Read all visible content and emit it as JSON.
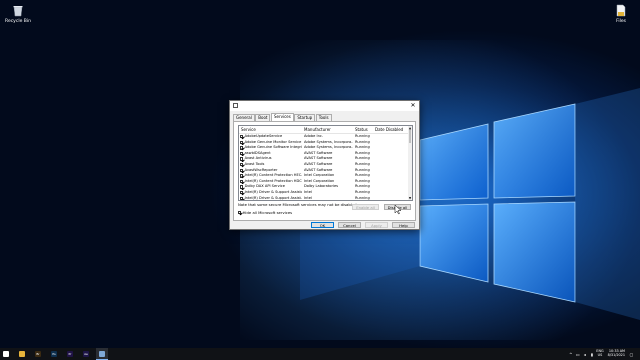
{
  "desktop": {
    "icons": [
      {
        "label": "Recycle Bin",
        "icon": "recycle-bin-icon"
      },
      {
        "label": "Files",
        "icon": "files-icon"
      }
    ],
    "accent": "#0a4fb0"
  },
  "dialog": {
    "close_label": "✕",
    "tabs": [
      "General",
      "Boot",
      "Services",
      "Startup",
      "Tools"
    ],
    "active_tab": "Services",
    "columns": [
      "Service",
      "Manufacturer",
      "Status",
      "Date Disabled"
    ],
    "rows": [
      {
        "checked": true,
        "service": "AdobeUpdateService",
        "manufacturer": "Adobe Inc.",
        "status": "Running",
        "date": ""
      },
      {
        "checked": true,
        "service": "Adobe Genuine Monitor Service",
        "manufacturer": "Adobe Systems, Incorpora...",
        "status": "Running",
        "date": ""
      },
      {
        "checked": true,
        "service": "Adobe Genuine Software Integri...",
        "manufacturer": "Adobe Systems, Incorpora...",
        "status": "Running",
        "date": ""
      },
      {
        "checked": true,
        "service": "aswbIDSAgent",
        "manufacturer": "AVAST Software",
        "status": "Running",
        "date": ""
      },
      {
        "checked": true,
        "service": "Avast Antivirus",
        "manufacturer": "AVAST Software",
        "status": "Running",
        "date": ""
      },
      {
        "checked": true,
        "service": "Avast Tools",
        "manufacturer": "AVAST Software",
        "status": "Running",
        "date": ""
      },
      {
        "checked": true,
        "service": "AvastWscReporter",
        "manufacturer": "AVAST Software",
        "status": "Running",
        "date": ""
      },
      {
        "checked": true,
        "service": "Intel(R) Content Protection HEC...",
        "manufacturer": "Intel Corporation",
        "status": "Running",
        "date": ""
      },
      {
        "checked": true,
        "service": "Intel(R) Content Protection HDC...",
        "manufacturer": "Intel Corporation",
        "status": "Running",
        "date": ""
      },
      {
        "checked": true,
        "service": "Dolby DAX API Service",
        "manufacturer": "Dolby Laboratories",
        "status": "Running",
        "date": ""
      },
      {
        "checked": true,
        "service": "Intel(R) Driver & Support Assistant",
        "manufacturer": "Intel",
        "status": "Running",
        "date": ""
      },
      {
        "checked": true,
        "service": "Intel(R) Driver & Support Assist...",
        "manufacturer": "Intel",
        "status": "Running",
        "date": ""
      }
    ],
    "note": "Note that some secure Microsoft services may not be disabled.",
    "enable_all": "Enable all",
    "disable_all": "Disable all",
    "hide_ms_label": "Hide all Microsoft services",
    "hide_ms_checked": true,
    "buttons": {
      "ok": "OK",
      "cancel": "Cancel",
      "apply": "Apply",
      "help": "Help"
    }
  },
  "taskbar": {
    "apps": [
      {
        "name": "windows-start-icon",
        "color": "#ffffff",
        "glyph": ""
      },
      {
        "name": "chrome-icon",
        "color": "#e7b43b",
        "glyph": ""
      },
      {
        "name": "bridge-icon",
        "color": "#3a2a12",
        "glyph": "Br"
      },
      {
        "name": "photoshop-icon",
        "color": "#0d2f4f",
        "glyph": "Ps"
      },
      {
        "name": "premiere-icon",
        "color": "#1f1246",
        "glyph": "Pr"
      },
      {
        "name": "after-effects-icon",
        "color": "#1d1548",
        "glyph": "Ae"
      },
      {
        "name": "settings-app-icon",
        "color": "#7fa8d6",
        "glyph": ""
      }
    ],
    "lang_top": "ENG",
    "lang_bottom": "US",
    "time": "10:33 AM",
    "date": "8/31/2021"
  }
}
